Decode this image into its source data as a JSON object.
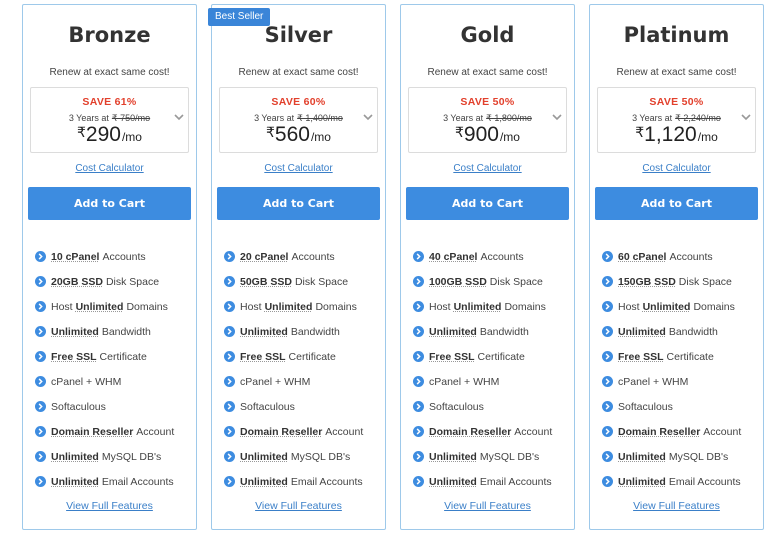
{
  "colors": {
    "accent": "#3d8ce0",
    "save": "#e2402c",
    "border": "#9ec9ea"
  },
  "renew_text": "Renew at exact same cost!",
  "years_label": "3 Years at",
  "currency": "₹",
  "per_label": "/mo",
  "calc_label": "Cost Calculator",
  "cart_label": "Add to Cart",
  "view_label": "View Full Features",
  "badge": "Best Seller",
  "plans": [
    {
      "name": "Bronze",
      "save": "SAVE 61%",
      "old_price": "₹ 750/mo",
      "price": "290",
      "features": [
        {
          "bold": "10 cPanel",
          "text": "Accounts"
        },
        {
          "bold": "20GB SSD",
          "text": "Disk Space"
        },
        {
          "pre": "Host",
          "bold": "Unlimited",
          "text": "Domains"
        },
        {
          "bold": "Unlimited",
          "text": "Bandwidth"
        },
        {
          "bold": "Free SSL",
          "text": "Certificate"
        },
        {
          "text": "cPanel + WHM"
        },
        {
          "text": "Softaculous"
        },
        {
          "bold": "Domain Reseller",
          "text": "Account"
        },
        {
          "bold": "Unlimited",
          "text": "MySQL DB's"
        },
        {
          "bold": "Unlimited",
          "text": "Email Accounts"
        }
      ]
    },
    {
      "name": "Silver",
      "save": "SAVE 60%",
      "old_price": "₹ 1,400/mo",
      "price": "560",
      "features": [
        {
          "bold": "20 cPanel",
          "text": "Accounts"
        },
        {
          "bold": "50GB SSD",
          "text": "Disk Space"
        },
        {
          "pre": "Host",
          "bold": "Unlimited",
          "text": "Domains"
        },
        {
          "bold": "Unlimited",
          "text": "Bandwidth"
        },
        {
          "bold": "Free SSL",
          "text": "Certificate"
        },
        {
          "text": "cPanel + WHM"
        },
        {
          "text": "Softaculous"
        },
        {
          "bold": "Domain Reseller",
          "text": "Account"
        },
        {
          "bold": "Unlimited",
          "text": "MySQL DB's"
        },
        {
          "bold": "Unlimited",
          "text": "Email Accounts"
        }
      ]
    },
    {
      "name": "Gold",
      "save": "SAVE 50%",
      "old_price": "₹ 1,800/mo",
      "price": "900",
      "features": [
        {
          "bold": "40 cPanel",
          "text": "Accounts"
        },
        {
          "bold": "100GB SSD",
          "text": "Disk Space"
        },
        {
          "pre": "Host",
          "bold": "Unlimited",
          "text": "Domains"
        },
        {
          "bold": "Unlimited",
          "text": "Bandwidth"
        },
        {
          "bold": "Free SSL",
          "text": "Certificate"
        },
        {
          "text": "cPanel + WHM"
        },
        {
          "text": "Softaculous"
        },
        {
          "bold": "Domain Reseller",
          "text": "Account"
        },
        {
          "bold": "Unlimited",
          "text": "MySQL DB's"
        },
        {
          "bold": "Unlimited",
          "text": "Email Accounts"
        }
      ]
    },
    {
      "name": "Platinum",
      "save": "SAVE 50%",
      "old_price": "₹ 2,240/mo",
      "price": "1,120",
      "features": [
        {
          "bold": "60 cPanel",
          "text": "Accounts"
        },
        {
          "bold": "150GB SSD",
          "text": "Disk Space"
        },
        {
          "pre": "Host",
          "bold": "Unlimited",
          "text": "Domains"
        },
        {
          "bold": "Unlimited",
          "text": "Bandwidth"
        },
        {
          "bold": "Free SSL",
          "text": "Certificate"
        },
        {
          "text": "cPanel + WHM"
        },
        {
          "text": "Softaculous"
        },
        {
          "bold": "Domain Reseller",
          "text": "Account"
        },
        {
          "bold": "Unlimited",
          "text": "MySQL DB's"
        },
        {
          "bold": "Unlimited",
          "text": "Email Accounts"
        }
      ]
    }
  ]
}
